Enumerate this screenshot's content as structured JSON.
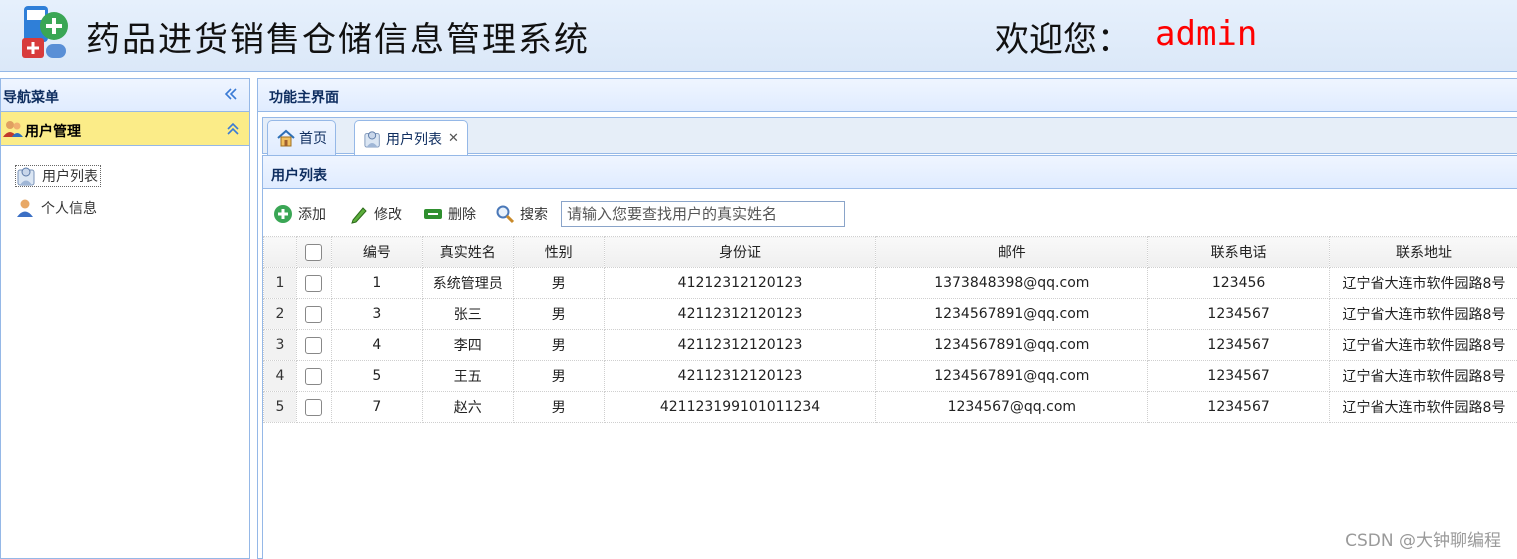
{
  "header": {
    "title": "药品进货销售仓储信息管理系统",
    "welcome_label": "欢迎您：",
    "username": "admin"
  },
  "nav": {
    "title": "导航菜单",
    "group": {
      "title": "用户管理"
    },
    "items": [
      {
        "label": "用户列表",
        "icon": "user-list-icon",
        "active": true
      },
      {
        "label": "个人信息",
        "icon": "person-icon",
        "active": false
      }
    ]
  },
  "main": {
    "title": "功能主界面",
    "tabs": [
      {
        "label": "首页",
        "icon": "home-icon"
      },
      {
        "label": "用户列表",
        "icon": "user-list-icon",
        "closable": true
      }
    ]
  },
  "list": {
    "title": "用户列表",
    "toolbar": {
      "add": "添加",
      "edit": "修改",
      "delete": "删除",
      "search": "搜索",
      "search_placeholder": "请输入您要查找用户的真实姓名"
    },
    "columns": [
      "编号",
      "真实姓名",
      "性别",
      "身份证",
      "邮件",
      "联系电话",
      "联系地址"
    ],
    "rows": [
      {
        "rownum": "1",
        "id": "1",
        "name": "系统管理员",
        "gender": "男",
        "idcard": "41212312120123",
        "email": "1373848398@qq.com",
        "phone": "123456",
        "address": "辽宁省大连市软件园路8号"
      },
      {
        "rownum": "2",
        "id": "3",
        "name": "张三",
        "gender": "男",
        "idcard": "42112312120123",
        "email": "1234567891@qq.com",
        "phone": "1234567",
        "address": "辽宁省大连市软件园路8号"
      },
      {
        "rownum": "3",
        "id": "4",
        "name": "李四",
        "gender": "男",
        "idcard": "42112312120123",
        "email": "1234567891@qq.com",
        "phone": "1234567",
        "address": "辽宁省大连市软件园路8号"
      },
      {
        "rownum": "4",
        "id": "5",
        "name": "王五",
        "gender": "男",
        "idcard": "42112312120123",
        "email": "1234567891@qq.com",
        "phone": "1234567",
        "address": "辽宁省大连市软件园路8号"
      },
      {
        "rownum": "5",
        "id": "7",
        "name": "赵六",
        "gender": "男",
        "idcard": "421123199101011234",
        "email": "1234567@qq.com",
        "phone": "1234567",
        "address": "辽宁省大连市软件园路8号"
      }
    ]
  },
  "watermark": "CSDN @大钟聊编程",
  "colors": {
    "header_bg": "#dbe8f8",
    "border": "#95b8e7",
    "accent_group": "#fbec88",
    "username": "#ff0000"
  }
}
